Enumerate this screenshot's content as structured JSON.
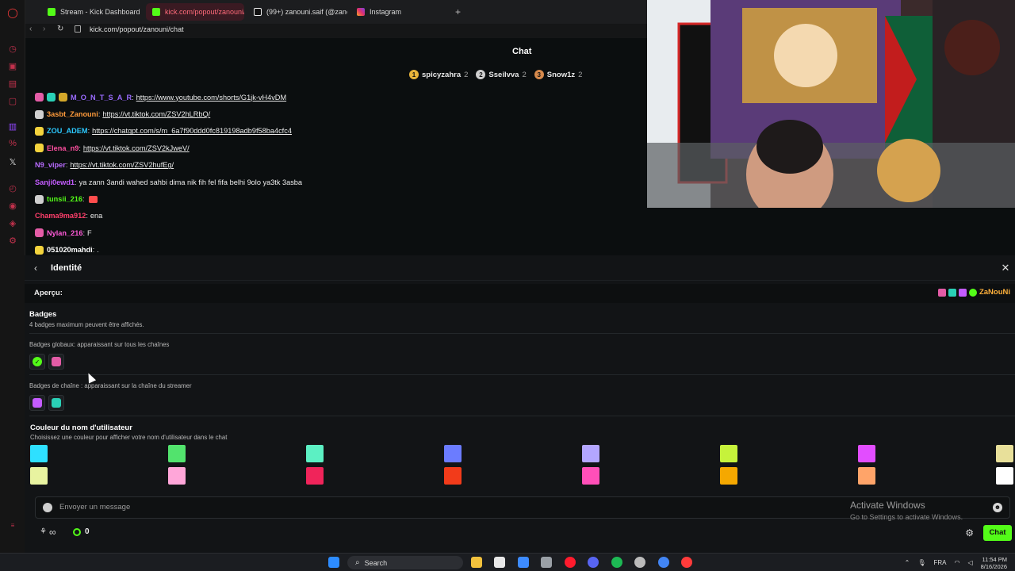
{
  "browser": {
    "tabs": [
      {
        "label": "Stream - Kick Dashboard",
        "favicon": "kick-icon",
        "color": "#53fc18"
      },
      {
        "label": "kick.com/popout/zanouni/",
        "favicon": "kick-icon",
        "color": "#53fc18",
        "active": true
      },
      {
        "label": "(99+) zanouni.saif (@zano",
        "favicon": "tiktok-icon",
        "color": "#ffffff"
      },
      {
        "label": "Instagram",
        "favicon": "instagram-icon",
        "color": "#e1306c"
      }
    ],
    "new_tab": "+",
    "address": "kick.com/popout/zanouni/chat"
  },
  "chat": {
    "title": "Chat",
    "top_gifters": [
      {
        "name": "spicyzahra",
        "count": "2",
        "rank": "1",
        "color": "#e8b43a"
      },
      {
        "name": "Sseilvva",
        "count": "2",
        "rank": "2",
        "color": "#cfcfcf"
      },
      {
        "name": "Snow1z",
        "count": "2",
        "rank": "3",
        "color": "#d78a4c"
      }
    ],
    "messages": [
      {
        "user": "M_O_N_T_S_A_R",
        "user_color": "#9a6bff",
        "text": "https://www.youtube.com/shorts/G1jk-vH4vDM",
        "link": true,
        "badges": [
          "#e35ca6",
          "#2ad0b6",
          "#d4a82a"
        ]
      },
      {
        "user": "3asbt_Zanouni",
        "user_color": "#ff9b3b",
        "text": "https://vt.tiktok.com/ZSV2hLRbQ/",
        "link": true,
        "badges": [
          "#cfcfcf"
        ]
      },
      {
        "user": "ZOU_ADEM",
        "user_color": "#2cc9ff",
        "text": "https://chatgpt.com/s/m_6a7f90ddd0fc819198adb9f58ba4cfc4",
        "link": true,
        "badges": [
          "#f3d33d"
        ]
      },
      {
        "user": "Elena_n9",
        "user_color": "#ff4fa0",
        "text": "https://vt.tiktok.com/ZSV2kJweV/",
        "link": true,
        "badges": [
          "#f3d33d"
        ]
      },
      {
        "user": "N9_viper",
        "user_color": "#b86bff",
        "text": "https://vt.tiktok.com/ZSV2hufEg/",
        "link": true,
        "badges": []
      },
      {
        "user": "Sanji0ewd1",
        "user_color": "#c45cff",
        "text": "ya zann 3andi wahed sahbi dima nik fih fel fifa belhi 9olo ya3tk 3asba",
        "link": false,
        "badges": []
      },
      {
        "user": "tunsii_216",
        "user_color": "#53fc18",
        "text": "",
        "link": false,
        "badges": [
          "#cfcfcf"
        ],
        "emote": true
      },
      {
        "user": "Chama9ma912",
        "user_color": "#ff3f6b",
        "text": "ena",
        "link": false,
        "badges": []
      },
      {
        "user": "Nylan_216",
        "user_color": "#ff5ad8",
        "text": "F",
        "link": false,
        "badges": [
          "#e35ca6"
        ]
      },
      {
        "user": "051020mahdi",
        "user_color": "#ffffff",
        "text": ".",
        "link": false,
        "badges": [
          "#f3d33d"
        ]
      }
    ],
    "separator": ":"
  },
  "identity": {
    "title": "Identité",
    "preview_label": "Aperçu:",
    "preview_user": "ZaNouNi",
    "preview_user_color": "#ffb13b",
    "preview_badges": [
      "#e35ca6",
      "#2ad0b6",
      "#c45cff",
      "#53fc18"
    ],
    "badges_title": "Badges",
    "badges_sub": "4 badges maximum peuvent être affichés.",
    "global_badges_label": "Badges globaux: apparaissant sur tous les chaînes",
    "global_badges": [
      "#53fc18",
      "#e35ca6"
    ],
    "channel_badges_label": "Badges de chaîne : apparaissant sur la chaîne du streamer",
    "channel_badges": [
      "#c45cff",
      "#2ad0b6"
    ],
    "color_title": "Couleur du nom d'utilisateur",
    "color_sub": "Choisissez une couleur pour afficher votre nom d'utilisateur dans le chat",
    "colors_row1": [
      "#2ee0ff",
      "#52e36d",
      "#5cf0c3",
      "#6b7cff",
      "#b3a6ff",
      "#c6f23b",
      "#e24dff",
      "#e8e09a"
    ],
    "colors_row2": [
      "#e8f3a0",
      "#ffa6d9",
      "#f0245a",
      "#f23b1a",
      "#ff4fb8",
      "#f5a800",
      "#ffa469",
      "#ffffff"
    ]
  },
  "composer": {
    "placeholder": "Envoyer un message",
    "chat_button": "Chat",
    "points": "0",
    "infinity": "∞"
  },
  "watermark": {
    "title": "Activate Windows",
    "subtitle": "Go to Settings to activate Windows."
  },
  "taskbar": {
    "search": "Search",
    "lang": "FRA",
    "time": "11:54 PM",
    "date": "8/16/2026"
  }
}
